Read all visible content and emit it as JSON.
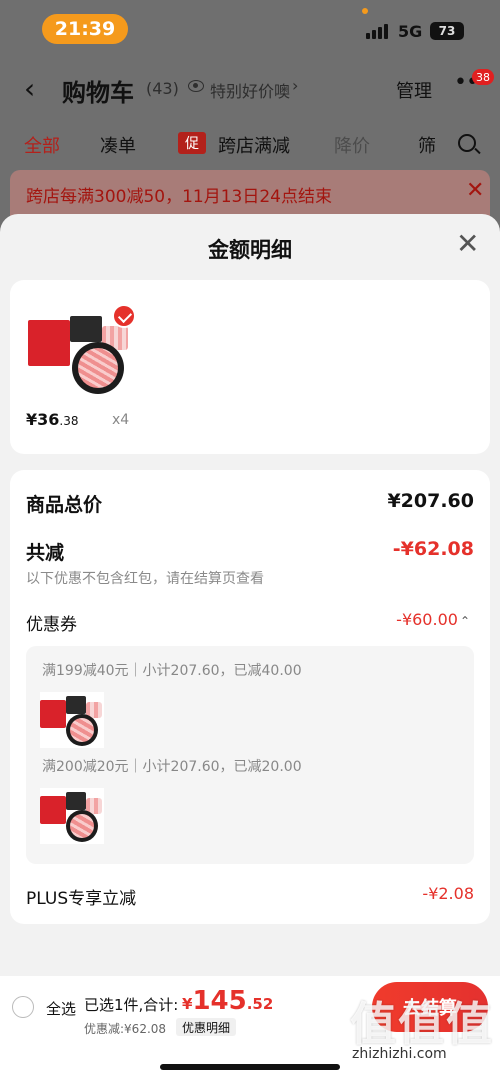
{
  "status_bar": {
    "time": "21:39",
    "network": "5G",
    "battery": "73"
  },
  "cart_header": {
    "title": "购物车",
    "count": "(43)",
    "price_watch": "特别好价噢",
    "manage": "管理",
    "more_badge": "38"
  },
  "tabs": [
    {
      "label": "全部"
    },
    {
      "label": "凑单"
    },
    {
      "label": "跨店满减",
      "tag": "促"
    },
    {
      "label": "降价"
    },
    {
      "label": "筛"
    }
  ],
  "banner": {
    "text": "跨店每满300减50，11月13日24点结束"
  },
  "sheet": {
    "title": "金额明细",
    "product": {
      "price_int": "¥36",
      "price_dec": ".38",
      "qty": "x4"
    },
    "summary": {
      "total_label": "商品总价",
      "total_value": "¥207.60",
      "discount_label": "共减",
      "discount_value": "-¥62.08",
      "note": "以下优惠不包含红包，请在结算页查看",
      "coupon_label": "优惠券",
      "coupon_value": "-¥60.00",
      "coupon_rows": [
        {
          "text": "满199减40元｜小计207.60，已减40.00"
        },
        {
          "text": "满200减20元｜小计207.60，已减20.00"
        }
      ],
      "plus_label": "PLUS专享立减",
      "plus_value": "-¥2.08"
    }
  },
  "bottom_bar": {
    "select_all": "全选",
    "selected": "已选1件,合计:",
    "total_sym": "¥",
    "total_int": "145",
    "total_dec": ".52",
    "discount": "优惠减:¥62.08",
    "detail": "优惠明细",
    "checkout": "去结算"
  },
  "watermark": {
    "text": "值值值",
    "url": "zhizhizhi.com"
  },
  "colors": {
    "accent": "#e5312b",
    "status_pill": "#f59a1c"
  }
}
